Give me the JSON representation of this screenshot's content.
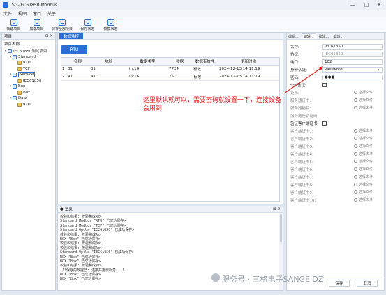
{
  "window": {
    "title": "SG-IEC61850-Modbus",
    "controls": [
      "—",
      "□",
      "✕"
    ]
  },
  "menu": [
    "文件",
    "视图",
    "窗口",
    "关于"
  ],
  "toolbar": [
    {
      "label": "新建项目",
      "icon": "new-project-icon"
    },
    {
      "label": "加载项目",
      "icon": "load-project-icon"
    },
    {
      "label": "保存全部项目",
      "icon": "save-all-icon"
    },
    {
      "label": "保存状态",
      "icon": "save-state-icon"
    },
    {
      "label": "恢复状态",
      "icon": "restore-state-icon"
    }
  ],
  "project_panel": {
    "title": "项目",
    "header": "项目名称",
    "tree": [
      {
        "label": "IEC61850测试项目",
        "level": 0,
        "expanded": true
      },
      {
        "label": "Standard",
        "level": 1,
        "expanded": true
      },
      {
        "label": "RTU",
        "level": 2
      },
      {
        "label": "TCP",
        "level": 2
      },
      {
        "label": "Service",
        "level": 1,
        "expanded": true,
        "selected": true
      },
      {
        "label": "IEC61850",
        "level": 2
      },
      {
        "label": "Box",
        "level": 1,
        "expanded": true
      },
      {
        "label": "Box",
        "level": 2
      },
      {
        "label": "Data",
        "level": 1,
        "expanded": true
      },
      {
        "label": "RTU",
        "level": 2
      }
    ]
  },
  "center": {
    "tab": "数据监控",
    "rtu_button": "RTU",
    "columns": [
      "名称",
      "地址",
      "数据类型",
      "数据",
      "数据有效性",
      "更新时间"
    ],
    "rows": [
      {
        "idx": "1",
        "name": "31",
        "addr": "31",
        "type": "int16",
        "value": "7724",
        "valid": "有效",
        "time": "2024-12-13 14:11:19"
      },
      {
        "idx": "2",
        "name": "41",
        "addr": "41",
        "type": "int16",
        "value": "25",
        "valid": "有效",
        "time": "2024-12-13 14:11:19"
      }
    ]
  },
  "console": {
    "title": "消息",
    "lines": [
      "校验和结果: 校验和成功>",
      "Standard Modbus \"RTU\" 已成功保存>",
      "Standard Modbus \"TCP\" 已成功保存>",
      "Standard OpcUa \"IEC61850\" 已成功保存>",
      "校验和结果: 校验和成功>",
      "BOX \"Box\" 已成功保存>",
      "校验和结果: 校验和成功>",
      "校验和结果: 校验和成功>",
      "Standard OpcUa \"IEC61850\" 已成功保存>",
      "BOX \"Box\" 已成功保存>",
      "BOX \"Box\" 已成功保存>",
      "校验和结果: 校验和成功>",
      "!!!保存的数据已: 连接并重启服务 !!!",
      "BOX \"Box\" 已成功保存>",
      "BOX \"Box\" 已成功保存>"
    ]
  },
  "props": {
    "tabs": [
      "编辑...",
      "编辑...",
      "编辑...",
      "编辑..."
    ],
    "rows": [
      {
        "label": "名称:",
        "value": "IEC61850",
        "kind": "text"
      },
      {
        "label": "协议:",
        "value": "IEC61850",
        "kind": "disabled"
      },
      {
        "label": "端口:",
        "value": "102",
        "kind": "text"
      },
      {
        "label": "身份认证:",
        "value": "Password",
        "kind": "select"
      },
      {
        "label": "密码:",
        "value": "●●●",
        "kind": "text"
      },
      {
        "label": "SSL验证:",
        "value": "",
        "kind": "check"
      },
      {
        "label": "证书:",
        "value": "选择文件",
        "kind": "pick"
      },
      {
        "label": "服务器证书:",
        "value": "选择文件",
        "kind": "pick"
      },
      {
        "label": "服务器秘钥:",
        "value": "选择文件",
        "kind": "pick"
      },
      {
        "label": "服务器秘钥密码:",
        "value": "",
        "kind": "none"
      },
      {
        "label": "验证客户端证书:",
        "value": "",
        "kind": "check"
      },
      {
        "label": "客户端证书1:",
        "value": "选择文件",
        "kind": "pick"
      },
      {
        "label": "客户端证书2:",
        "value": "选择文件",
        "kind": "pick"
      },
      {
        "label": "客户端证书3:",
        "value": "选择文件",
        "kind": "pick"
      },
      {
        "label": "客户端证书4:",
        "value": "选择文件",
        "kind": "pick"
      },
      {
        "label": "客户端证书5:",
        "value": "选择文件",
        "kind": "pick"
      },
      {
        "label": "客户端证书6:",
        "value": "选择文件",
        "kind": "pick"
      },
      {
        "label": "客户端证书7:",
        "value": "选择文件",
        "kind": "pick"
      },
      {
        "label": "客户端证书8:",
        "value": "选择文件",
        "kind": "pick"
      },
      {
        "label": "客户端证书9:",
        "value": "选择文件",
        "kind": "pick"
      },
      {
        "label": "客户端证书10:",
        "value": "选择文件",
        "kind": "pick"
      }
    ],
    "save_label": "保存",
    "cancel_label": "取消"
  },
  "annotation": {
    "text": "这里默认就可以，需要密码就设置一下，连接设备会用到",
    "color": "#e52222"
  },
  "watermark": "服务号 · 三格电子SANGE DZ",
  "accent": "#2b6fd6"
}
